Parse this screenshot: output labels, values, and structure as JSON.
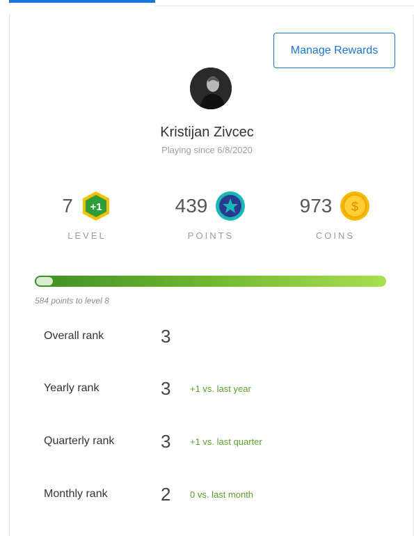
{
  "profile": {
    "manage_button": "Manage Rewards",
    "name": "Kristijan Zivcec",
    "playing_since": "Playing since 6/8/2020"
  },
  "stats": {
    "level": {
      "value": "7",
      "label": "LEVEL",
      "badge": "+1",
      "icon": "level-hexagon-icon",
      "color": "#2e9e3a",
      "border": "#f2c200"
    },
    "points": {
      "value": "439",
      "label": "POINTS",
      "icon": "star-seal-icon",
      "color": "#2b3a8f",
      "border": "#19b7b7"
    },
    "coins": {
      "value": "973",
      "label": "COINS",
      "icon": "coin-icon",
      "color": "#f6b800",
      "symbol": "$"
    }
  },
  "progress": {
    "text": "584 points to level 8",
    "fraction": 1.0,
    "colors": {
      "start": "#3f8f27",
      "end": "#a8df52"
    }
  },
  "ranks": [
    {
      "label": "Overall rank",
      "value": "3",
      "delta": ""
    },
    {
      "label": "Yearly rank",
      "value": "3",
      "delta": "+1 vs. last year"
    },
    {
      "label": "Quarterly rank",
      "value": "3",
      "delta": "+1 vs. last quarter"
    },
    {
      "label": "Monthly rank",
      "value": "2",
      "delta": "0 vs. last month"
    }
  ],
  "colors": {
    "accent": "#1976d2",
    "positive": "#5aa02c"
  }
}
